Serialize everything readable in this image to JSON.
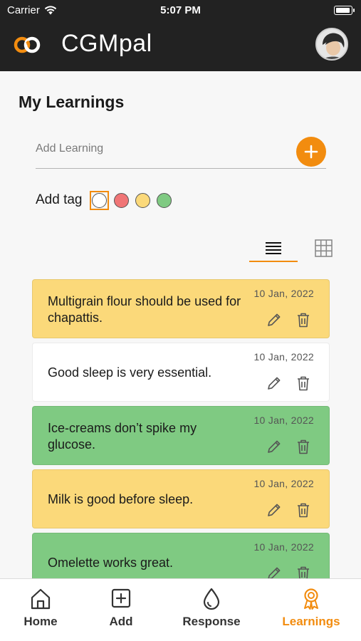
{
  "status_bar": {
    "carrier": "Carrier",
    "time": "5:07 PM"
  },
  "app": {
    "title": "CGMpal"
  },
  "page": {
    "title": "My Learnings"
  },
  "add_learning": {
    "placeholder": "Add Learning"
  },
  "tags": {
    "label": "Add tag",
    "options": [
      {
        "name": "none",
        "color": "#ffffff"
      },
      {
        "name": "red",
        "color": "#f07576"
      },
      {
        "name": "yellow",
        "color": "#fbd97a"
      },
      {
        "name": "green",
        "color": "#7fca82"
      }
    ],
    "selected": "none"
  },
  "view_mode": "list",
  "learnings": [
    {
      "text": "Multigrain flour should be used for chapattis.",
      "date": "10 Jan, 2022",
      "color": "#fbd97a"
    },
    {
      "text": "Good sleep is very essential.",
      "date": "10 Jan, 2022",
      "color": "#ffffff"
    },
    {
      "text": "Ice-creams don’t spike my glucose.",
      "date": "10 Jan, 2022",
      "color": "#7fca82"
    },
    {
      "text": "Milk is good before sleep.",
      "date": "10 Jan, 2022",
      "color": "#fbd97a"
    },
    {
      "text": "Omelette works great.",
      "date": "10 Jan, 2022",
      "color": "#7fca82"
    }
  ],
  "bottom_nav": {
    "items": [
      {
        "label": "Home",
        "icon": "home-icon"
      },
      {
        "label": "Add",
        "icon": "add-square-icon"
      },
      {
        "label": "Response",
        "icon": "drop-icon"
      },
      {
        "label": "Learnings",
        "icon": "badge-icon"
      }
    ],
    "active": "Learnings"
  },
  "colors": {
    "accent": "#f28c0f",
    "header": "#222222",
    "background": "#f7f7f7"
  }
}
